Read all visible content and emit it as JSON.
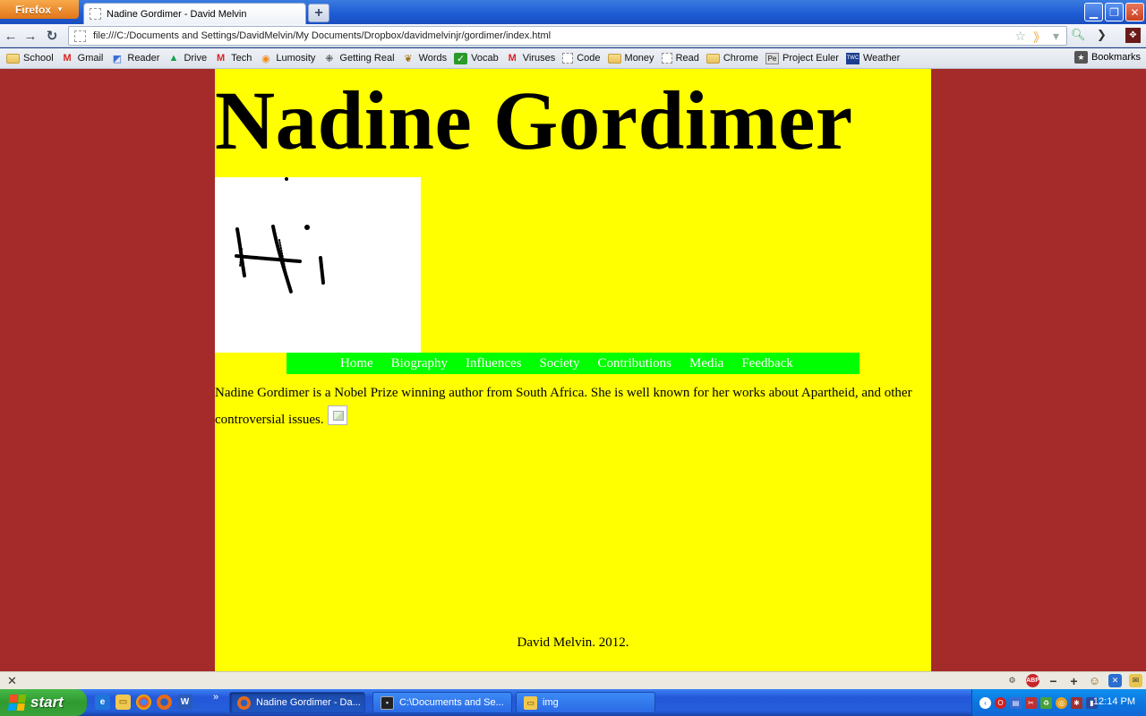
{
  "browser": {
    "menu_label": "Firefox",
    "tab_title": "Nadine Gordimer - David Melvin",
    "url": "file:///C:/Documents and Settings/DavidMelvin/My Documents/Dropbox/davidmelvinjr/gordimer/index.html"
  },
  "bookmarks": {
    "items": [
      {
        "label": "School",
        "icon": "folder-icon"
      },
      {
        "label": "Gmail",
        "icon": "gmail-icon"
      },
      {
        "label": "Reader",
        "icon": "reader-icon"
      },
      {
        "label": "Drive",
        "icon": "drive-icon"
      },
      {
        "label": "Tech",
        "icon": "gmail-icon"
      },
      {
        "label": "Lumosity",
        "icon": "lumosity-icon"
      },
      {
        "label": "Getting Real",
        "icon": "getting-real-icon"
      },
      {
        "label": "Words",
        "icon": "words-icon"
      },
      {
        "label": "Vocab",
        "icon": "checkmark-icon"
      },
      {
        "label": "Viruses",
        "icon": "gmail-icon"
      },
      {
        "label": "Code",
        "icon": "blank-page-icon"
      },
      {
        "label": "Money",
        "icon": "folder-icon"
      },
      {
        "label": "Read",
        "icon": "blank-page-icon"
      },
      {
        "label": "Chrome",
        "icon": "folder-icon"
      },
      {
        "label": "Project Euler",
        "icon": "project-euler-icon"
      },
      {
        "label": "Weather",
        "icon": "twc-icon"
      }
    ],
    "other_label": "Bookmarks"
  },
  "page": {
    "title": "Nadine Gordimer",
    "nav": [
      "Home",
      "Biography",
      "Influences",
      "Society",
      "Contributions",
      "Media",
      "Feedback"
    ],
    "intro": "Nadine Gordimer is a Nobel Prize winning author from South Africa. She is well known for her works about Apartheid, and other controversial issues.",
    "footer": "David Melvin. 2012.",
    "colors": {
      "page_bg": "#ffff00",
      "outer_bg": "#a52a2a",
      "nav_bg": "#00ff00",
      "nav_text": "#ffffff"
    }
  },
  "status": {
    "abp_label": "ABP"
  },
  "taskbar": {
    "start_label": "start",
    "windows": [
      {
        "label": "Nadine Gordimer - Da...",
        "icon": "firefox-icon",
        "active": true
      },
      {
        "label": "C:\\Documents and Se...",
        "icon": "cmd-icon",
        "active": false
      },
      {
        "label": "img",
        "icon": "folder-icon",
        "active": false
      }
    ],
    "clock": "12:14 PM"
  }
}
